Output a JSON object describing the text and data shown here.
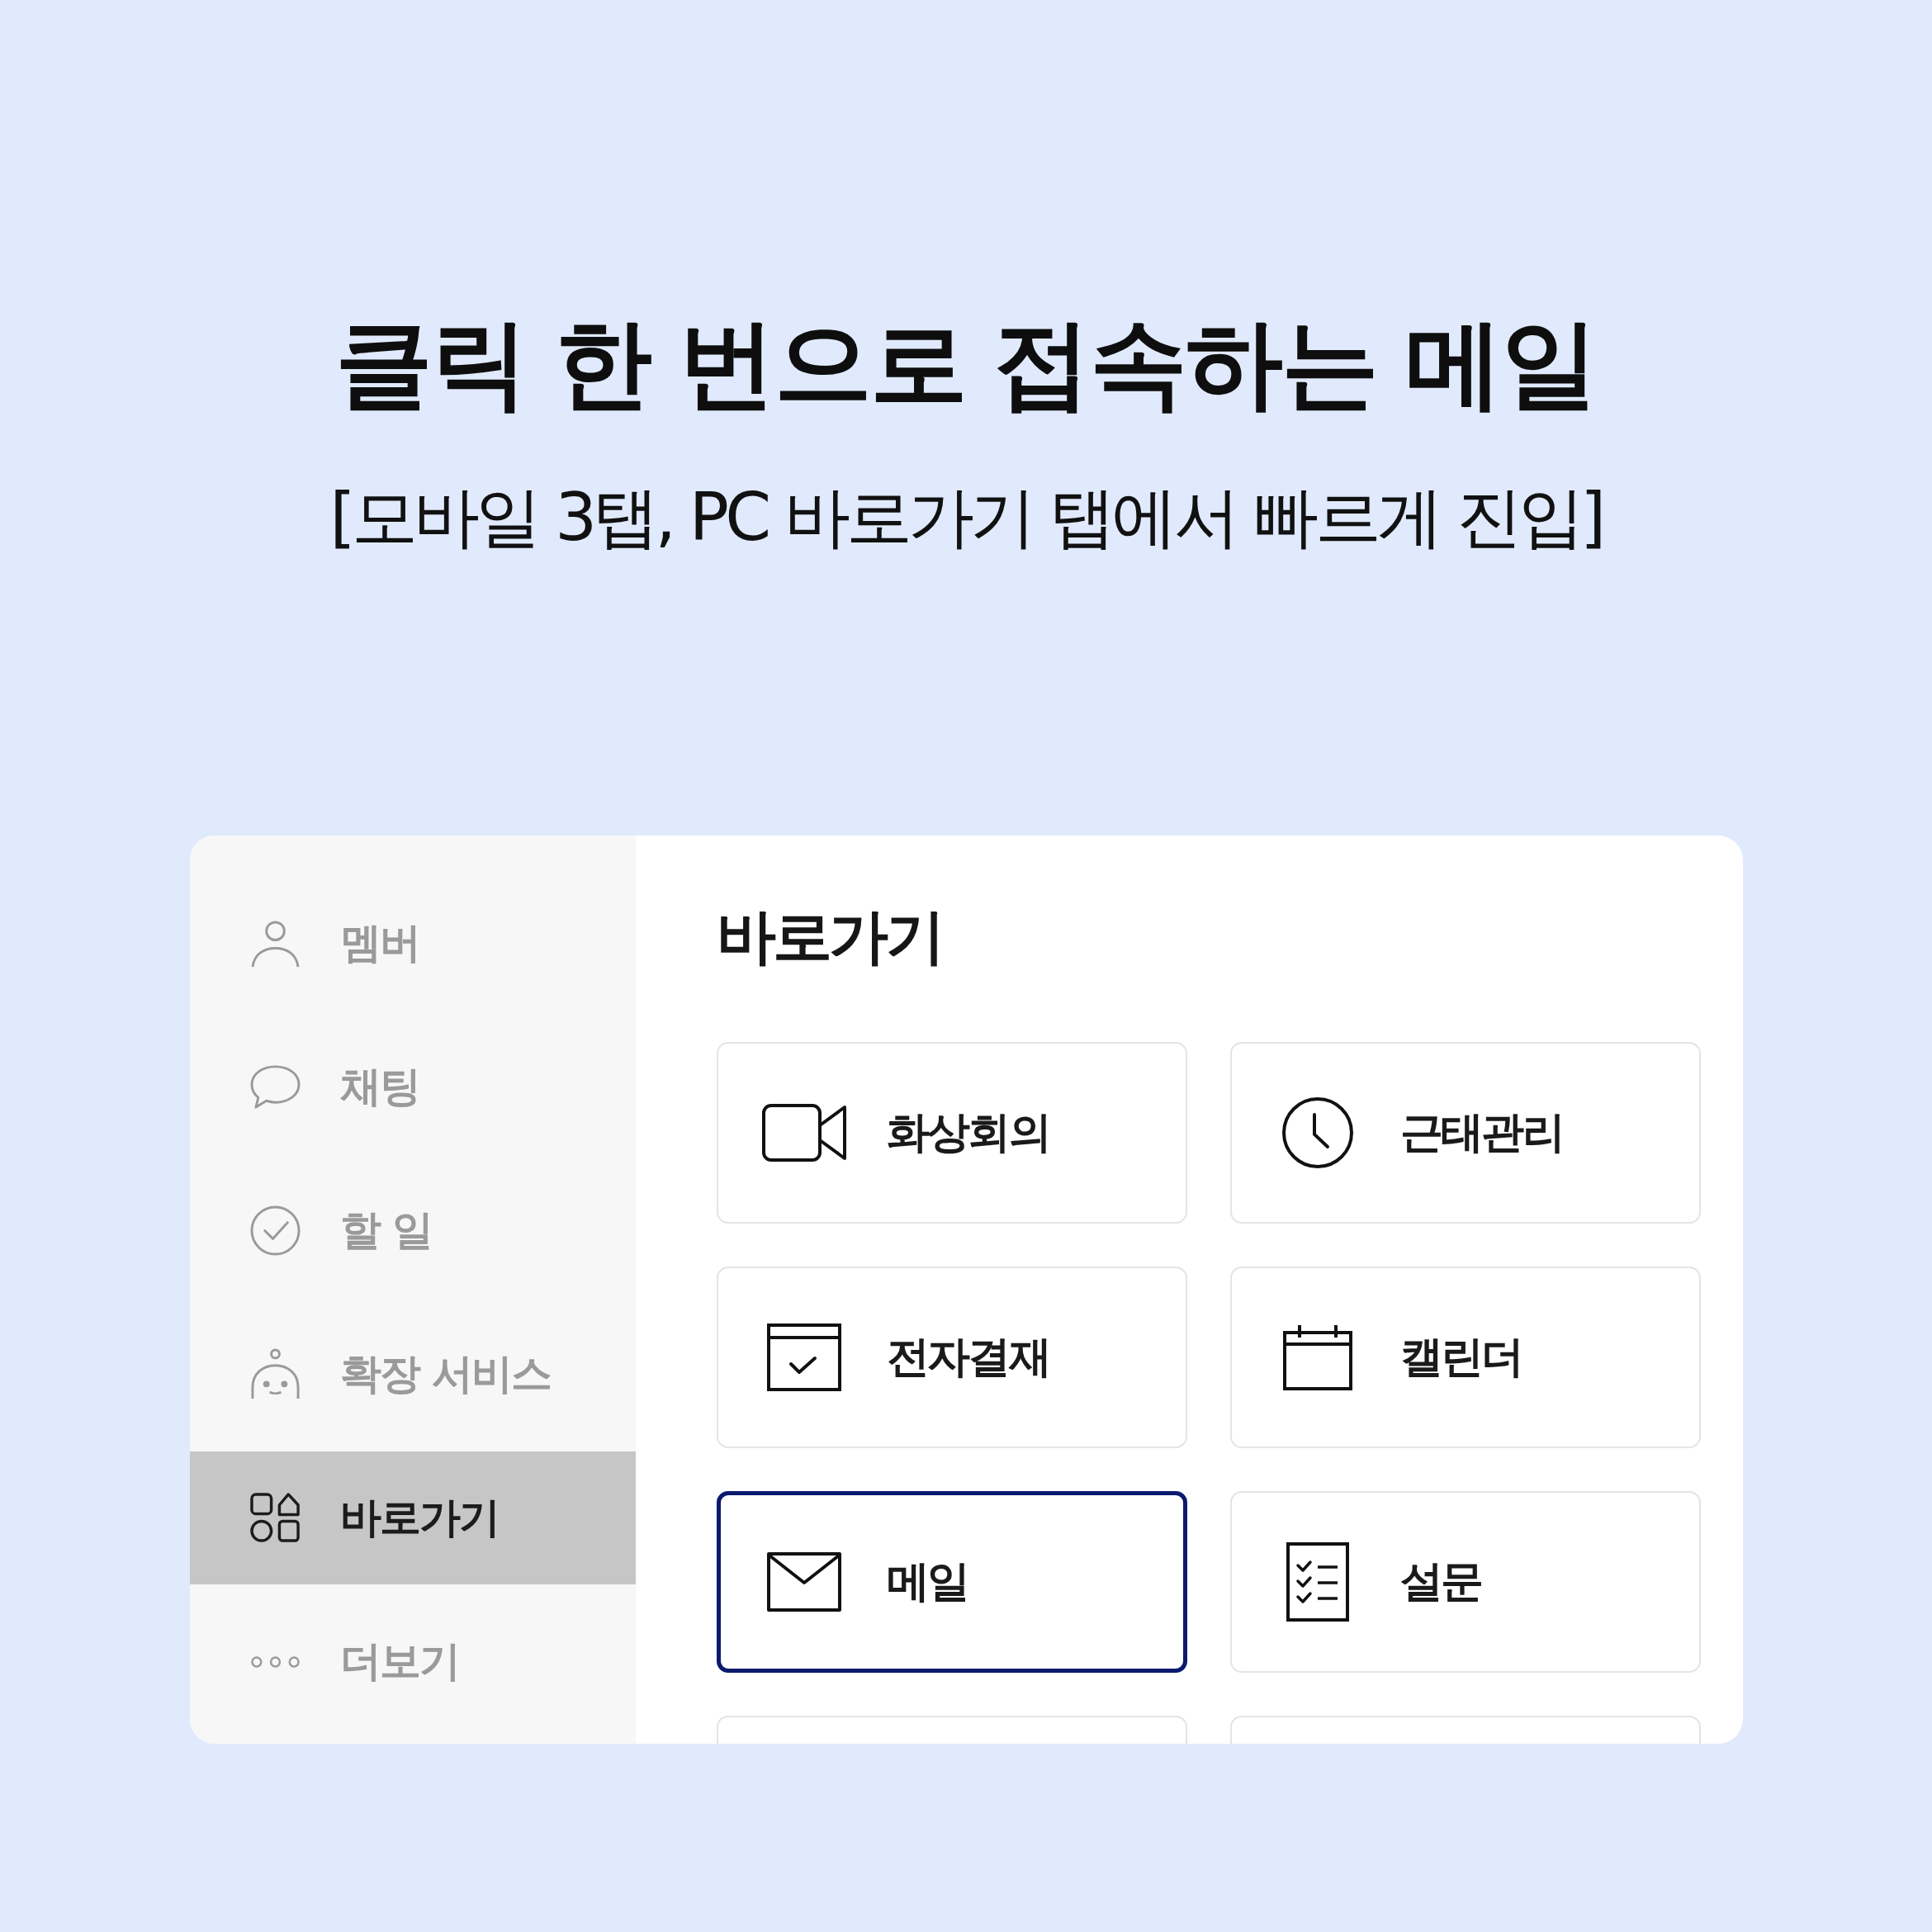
{
  "header": {
    "title": "클릭 한 번으로 접속하는 메일",
    "subtitle": "[모바일 3탭, PC 바로가기 탭에서 빠르게 진입]"
  },
  "sidebar": {
    "items": [
      {
        "kind": "member",
        "label": "멤버",
        "selected": false
      },
      {
        "kind": "chat",
        "label": "채팅",
        "selected": false
      },
      {
        "kind": "todo",
        "label": "할 일",
        "selected": false
      },
      {
        "kind": "extension",
        "label": "확장 서비스",
        "selected": false
      },
      {
        "kind": "shortcut",
        "label": "바로가기",
        "selected": true
      },
      {
        "kind": "more",
        "label": "더보기",
        "selected": false
      }
    ]
  },
  "shortcuts": {
    "title": "바로가기",
    "tiles": [
      {
        "kind": "video",
        "label": "화상회의",
        "selected": false
      },
      {
        "kind": "clock",
        "label": "근태관리",
        "selected": false
      },
      {
        "kind": "approval",
        "label": "전자결재",
        "selected": false
      },
      {
        "kind": "calendar",
        "label": "캘린더",
        "selected": false
      },
      {
        "kind": "mail",
        "label": "메일",
        "selected": true
      },
      {
        "kind": "survey",
        "label": "설문",
        "selected": false
      },
      {
        "selected": false
      },
      {
        "selected": false
      }
    ]
  }
}
